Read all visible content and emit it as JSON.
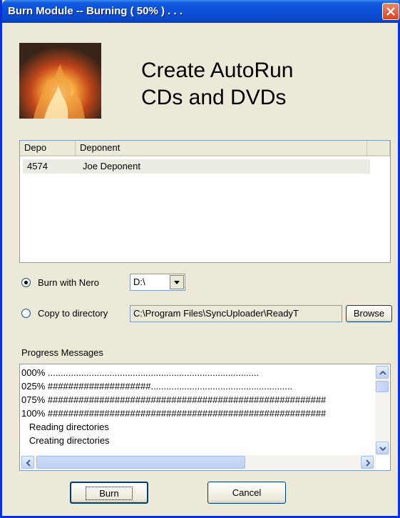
{
  "window": {
    "title": "Burn Module -- Burning ( 50% ) . . . ",
    "close_icon": "close-icon",
    "title_bar_color": "#0a48c8"
  },
  "header": {
    "line1": "Create AutoRun",
    "line2": "CDs and DVDs",
    "image_icon": "fire-image"
  },
  "deponent_list": {
    "columns": [
      "Depo",
      "Deponent"
    ],
    "rows": [
      {
        "depo": "4574",
        "deponent": "Joe Deponent"
      }
    ]
  },
  "burn_options": {
    "burn_with_nero_label": "Burn with Nero",
    "burn_with_nero_selected": true,
    "drive_value": "D:\\",
    "copy_to_directory_label": "Copy to directory",
    "copy_to_directory_selected": false,
    "directory_value": "C:\\Program Files\\SyncUploader\\ReadyT",
    "browse_label": "Browse"
  },
  "progress": {
    "label": "Progress Messages",
    "messages": [
      "000% ..................................................................................",
      "025% ####################.......................................................",
      "075% ######################################################",
      "100% ######################################################",
      "   Reading directories",
      "   Creating directories"
    ]
  },
  "footer": {
    "burn_label": "Burn",
    "cancel_label": "Cancel"
  }
}
